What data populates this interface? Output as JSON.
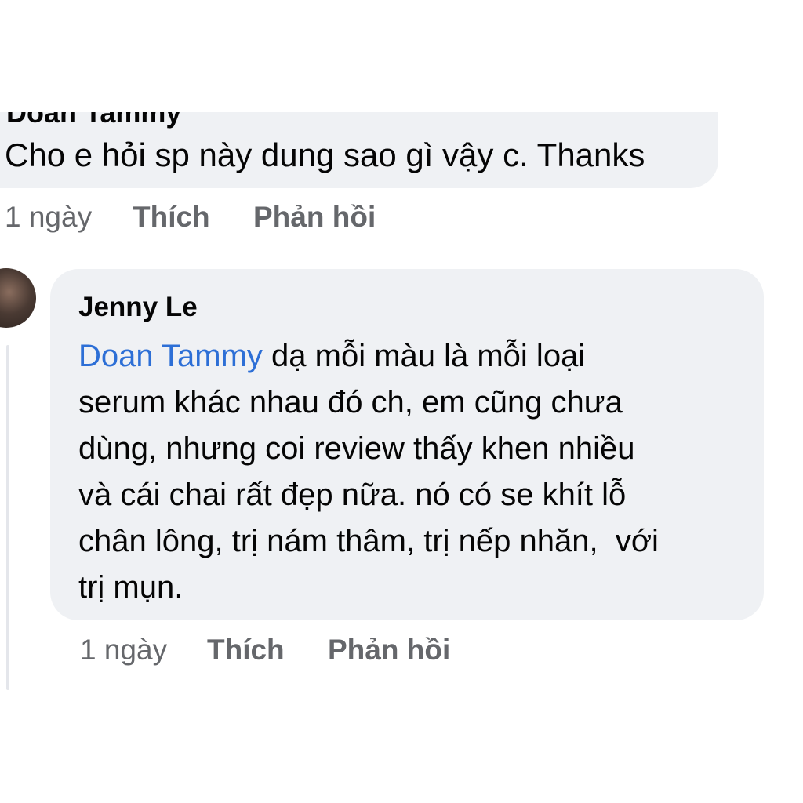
{
  "comments": [
    {
      "author": "Doan Tammy",
      "text": "Cho e hỏi sp này dung sao gì vậy c. Thanks",
      "time": "1 ngày",
      "like_label": "Thích",
      "reply_label": "Phản hồi"
    },
    {
      "author": "Jenny Le",
      "mention": "Doan Tammy",
      "lines": [
        " dạ mỗi màu là mỗi loại",
        "serum khác nhau đó ch, em cũng chưa",
        "dùng, nhưng coi review thấy khen nhiều",
        "và cái chai rất đẹp nữa. nó có se khít lỗ",
        "chân lông, trị nám thâm, trị nếp nhăn,  với",
        "trị mụn."
      ],
      "time": "1 ngày",
      "like_label": "Thích",
      "reply_label": "Phản hồi"
    }
  ],
  "colors": {
    "bubble": "#eff1f4",
    "meta_text": "#65676b",
    "mention": "#2d6fd6",
    "thread_line": "#e4e6eb"
  }
}
